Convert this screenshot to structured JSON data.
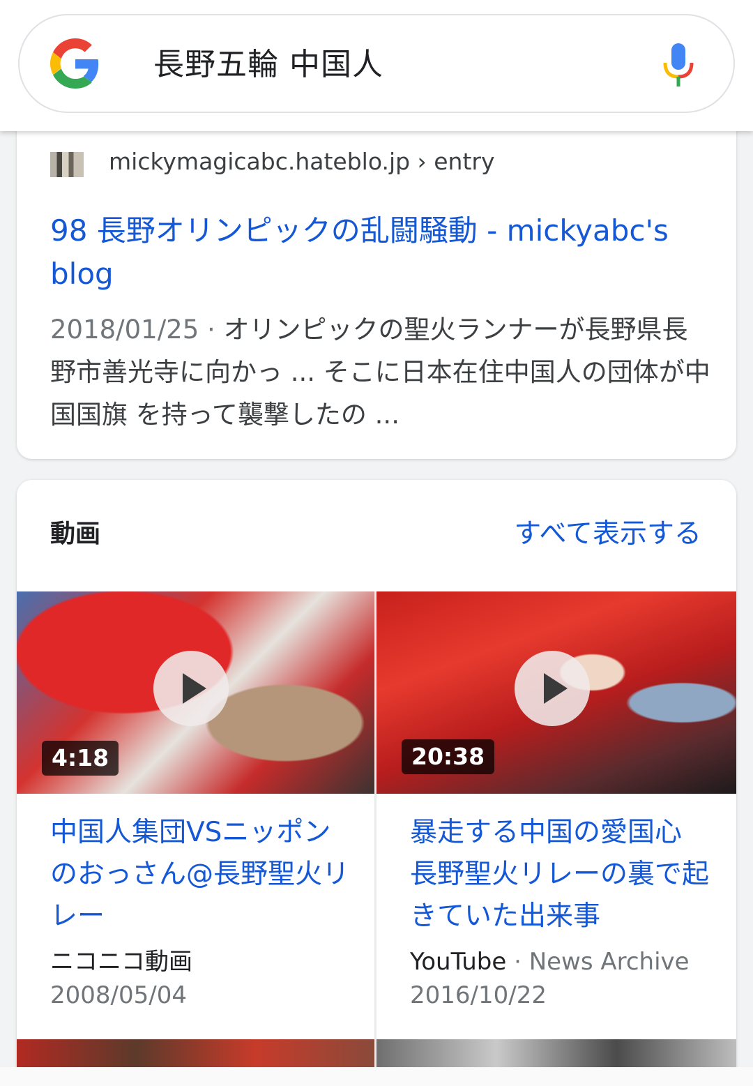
{
  "search": {
    "query": "長野五輪 中国人"
  },
  "result": {
    "site_url": "mickymagicabc.hateblo.jp › entry",
    "title": "98 長野オリンピックの乱闘騒動 - mickyabc's blog",
    "date": "2018/01/25",
    "date_sep": " · ",
    "snippet": "オリンピックの聖火ランナーが長野県長野市善光寺に向かっ ... そこに日本在住中国人の団体が中国国旗 を持って襲撃したの ..."
  },
  "videos": {
    "section_title": "動画",
    "show_all": "すべて表示する",
    "items": [
      {
        "duration": "4:18",
        "title": "中国人集団VSニッポンのおっさん@長野聖火リレー",
        "source": "ニコニコ動画",
        "source_extra": "",
        "date": "2008/05/04"
      },
      {
        "duration": "20:38",
        "title": "暴走する中国の愛国心 長野聖火リレーの裏で起きていた出来事",
        "source": "YouTube",
        "source_extra": " · News Archive",
        "date": "2016/10/22"
      }
    ]
  },
  "colors": {
    "link": "#1558d6",
    "google_blue": "#4285F4",
    "google_red": "#EA4335",
    "google_yellow": "#FBBC05",
    "google_green": "#34A853"
  }
}
